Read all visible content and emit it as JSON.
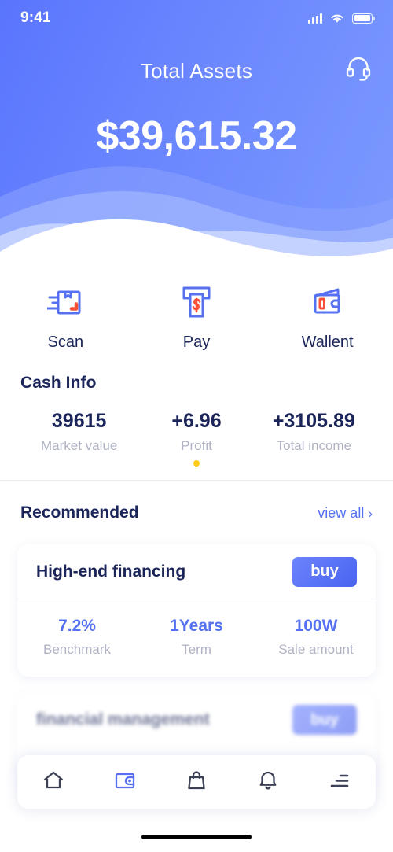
{
  "status_bar": {
    "time": "9:41",
    "signal_icon": "signal-bars-icon",
    "wifi_icon": "wifi-icon",
    "battery_icon": "battery-icon"
  },
  "header": {
    "title": "Total Assets",
    "balance": "$39,615.32",
    "support_icon": "headset-support-icon",
    "gradient_from": "#5a75fd",
    "gradient_to": "#7c9afe"
  },
  "quick_actions": [
    {
      "label": "Scan",
      "icon": "scan-package-icon"
    },
    {
      "label": "Pay",
      "icon": "atm-pay-icon"
    },
    {
      "label": "Wallent",
      "icon": "wallet-icon"
    }
  ],
  "cash_info": {
    "title": "Cash Info",
    "indicator_color": "#ffc91d",
    "stats": [
      {
        "value": "39615",
        "label": "Market value",
        "has_dot": false
      },
      {
        "value": "+6.96",
        "label": "Profit",
        "has_dot": true
      },
      {
        "value": "+3105.89",
        "label": "Total income",
        "has_dot": false
      }
    ]
  },
  "recommended": {
    "title": "Recommended",
    "view_all_label": "view all",
    "chevron": "›",
    "accent_color": "#5570f1",
    "cards": [
      {
        "name": "High-end financing",
        "buy_label": "buy",
        "stats": [
          {
            "value": "7.2%",
            "label": "Benchmark"
          },
          {
            "value": "1Years",
            "label": "Term"
          },
          {
            "value": "100W",
            "label": "Sale amount"
          }
        ]
      },
      {
        "name": "financial management",
        "buy_label": "buy",
        "stats": []
      }
    ]
  },
  "bottom_nav": [
    {
      "icon": "home-icon",
      "active": false
    },
    {
      "icon": "wallet-nav-icon",
      "active": true
    },
    {
      "icon": "shopping-bag-icon",
      "active": false
    },
    {
      "icon": "bell-icon",
      "active": false
    },
    {
      "icon": "menu-list-icon",
      "active": false
    }
  ]
}
